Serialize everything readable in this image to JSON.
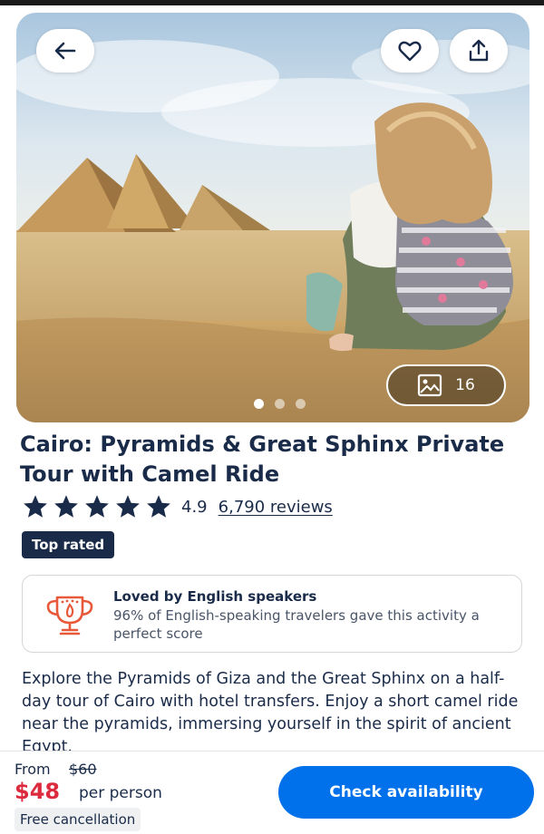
{
  "hero": {
    "photo_count": "16",
    "total_slides": 3,
    "active_slide": 1,
    "icons": {
      "back": "arrow-left-icon",
      "favorite": "heart-icon",
      "share": "share-icon",
      "gallery": "image-icon"
    }
  },
  "activity": {
    "title": "Cairo: Pyramids & Great Sphinx Private Tour with Camel Ride",
    "rating": "4.9",
    "stars": 5,
    "reviews": "6,790 reviews",
    "badge": "Top rated"
  },
  "loved_card": {
    "icon": "trophy-icon",
    "title": "Loved by English speakers",
    "description": "96% of English-speaking travelers gave this activity a perfect score"
  },
  "description": "Explore the Pyramids of Giza and the Great Sphinx on a half-day tour of Cairo with hotel transfers. Enjoy a short camel ride near the pyramids, immersing yourself in the spirit of ancient Egypt.",
  "footer": {
    "from_label": "From",
    "old_price": "$60",
    "price": "$48",
    "per_person": "per person",
    "free_cancellation": "Free cancellation",
    "cta_label": "Check availability"
  },
  "colors": {
    "navy": "#1a2b49",
    "price_red": "#dc2b3e",
    "cta_blue": "#0071eb",
    "trophy_orange": "#e8593a"
  }
}
